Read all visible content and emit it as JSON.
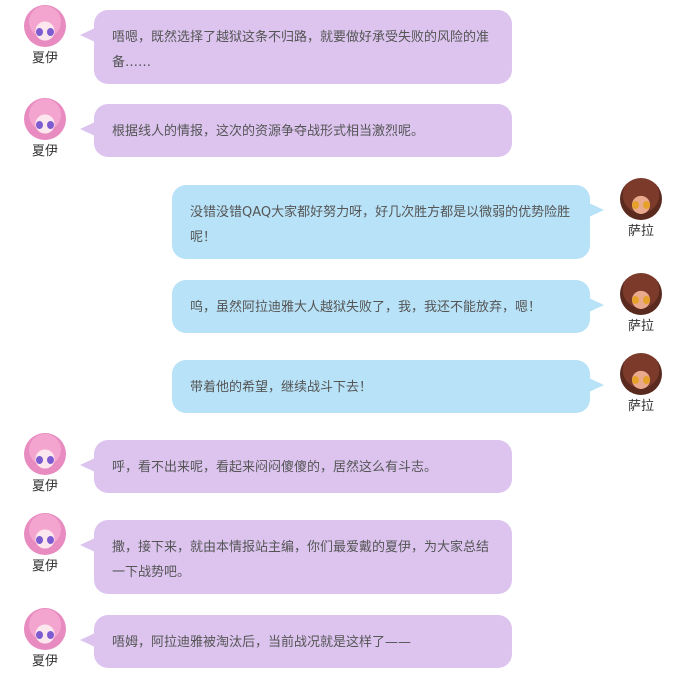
{
  "speakers": {
    "xiayi": "夏伊",
    "sala": "萨拉"
  },
  "messages": [
    {
      "speaker": "夏伊",
      "side": "left",
      "text": "唔嗯，既然选择了越狱这条不归路，就要做好承受失败的风险的准备……"
    },
    {
      "speaker": "夏伊",
      "side": "left",
      "text": "根据线人的情报，这次的资源争夺战形式相当激烈呢。"
    },
    {
      "speaker": "萨拉",
      "side": "right",
      "text": "没错没错QAQ大家都好努力呀，好几次胜方都是以微弱的优势险胜呢！"
    },
    {
      "speaker": "萨拉",
      "side": "right",
      "text": "呜，虽然阿拉迪雅大人越狱失败了，我，我还不能放弃，嗯！"
    },
    {
      "speaker": "萨拉",
      "side": "right",
      "text": "带着他的希望，继续战斗下去！"
    },
    {
      "speaker": "夏伊",
      "side": "left",
      "text": "呼，看不出来呢，看起来闷闷傻傻的，居然这么有斗志。"
    },
    {
      "speaker": "夏伊",
      "side": "left",
      "text": "撒，接下来，就由本情报站主编，你们最爱戴的夏伊，为大家总结一下战势吧。"
    },
    {
      "speaker": "夏伊",
      "side": "left",
      "text": "唔姆，阿拉迪雅被淘汰后，当前战况就是这样了——"
    }
  ],
  "colors": {
    "left_bubble": "#dcc4ef",
    "right_bubble": "#b8e2f7",
    "text": "#555555"
  }
}
